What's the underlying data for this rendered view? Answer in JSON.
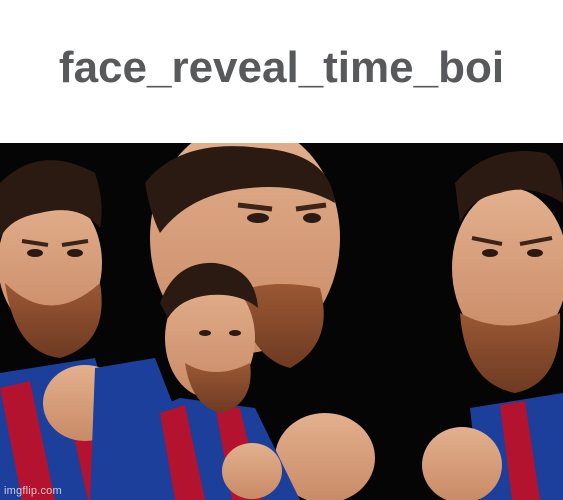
{
  "caption": {
    "text": "face_reveal_time_boi"
  },
  "image": {
    "subject": "repeated-faces-collage",
    "watermark": "imgflip.com",
    "colors": {
      "background": "#050505",
      "jersey_blue": "#1b3f9b",
      "jersey_red": "#b3132e",
      "skin": "#d6a07c",
      "beard": "#8a4b2b",
      "hair": "#2a1a12"
    }
  }
}
